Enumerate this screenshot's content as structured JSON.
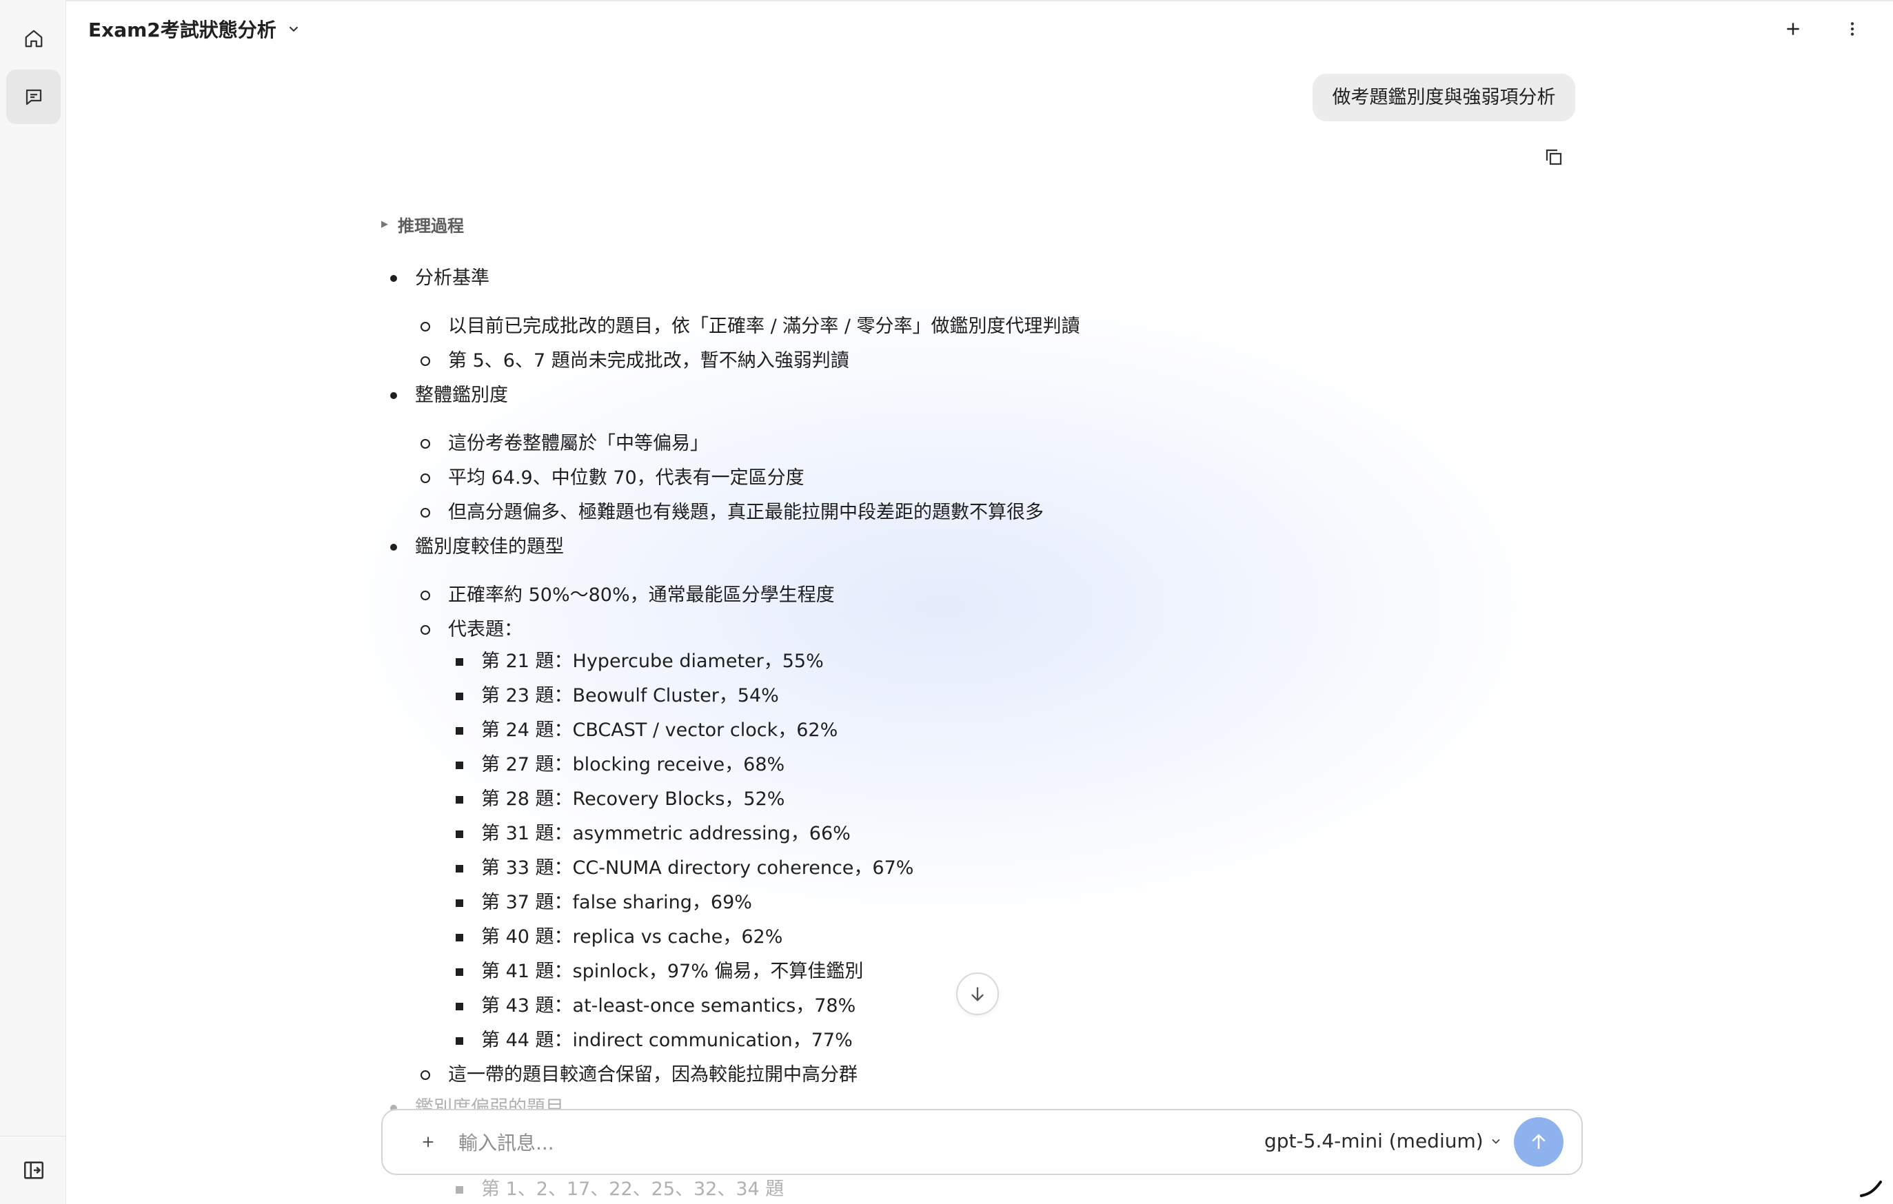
{
  "sidebar": {
    "home_icon": "home-icon",
    "chat_icon": "chat-icon",
    "collapse_icon": "sidebar-toggle-icon"
  },
  "header": {
    "title": "Exam2考試狀態分析",
    "new_chat_icon": "plus-icon",
    "more_icon": "more-vertical-icon"
  },
  "user_message": "做考題鑑別度與強弱項分析",
  "reasoning_label": "推理過程",
  "response": {
    "sections": [
      {
        "heading": "分析基準",
        "items": [
          "以目前已完成批改的題目，依「正確率 / 滿分率 / 零分率」做鑑別度代理判讀",
          "第 5、6、7 題尚未完成批改，暫不納入強弱判讀"
        ]
      },
      {
        "heading": "整體鑑別度",
        "items": [
          "這份考卷整體屬於「中等偏易」",
          "平均 64.9、中位數 70，代表有一定區分度",
          "但高分題偏多、極難題也有幾題，真正最能拉開中段差距的題數不算很多"
        ]
      },
      {
        "heading": "鑑別度較佳的題型",
        "items": [
          "正確率約 50%～80%，通常最能區分學生程度",
          "代表題："
        ],
        "subitems": [
          "第 21 題：Hypercube diameter，55%",
          "第 23 題：Beowulf Cluster，54%",
          "第 24 題：CBCAST / vector clock，62%",
          "第 27 題：blocking receive，68%",
          "第 28 題：Recovery Blocks，52%",
          "第 31 題：asymmetric addressing，66%",
          "第 33 題：CC-NUMA directory coherence，67%",
          "第 37 題：false sharing，69%",
          "第 40 題：replica vs cache，62%",
          "第 41 題：spinlock，97% 偏易，不算佳鑑別",
          "第 43 題：at-least-once semantics，78%",
          "第 44 題：indirect communication，77%"
        ],
        "closing": "這一帶的題目較適合保留，因為較能拉開中高分群"
      },
      {
        "heading": "鑑別度偏弱的題目",
        "subitems": [
          "第 1、2、17、22、25、32、34 題"
        ]
      }
    ]
  },
  "composer": {
    "placeholder": "輸入訊息...",
    "model": "gpt-5.4-mini (medium)"
  }
}
